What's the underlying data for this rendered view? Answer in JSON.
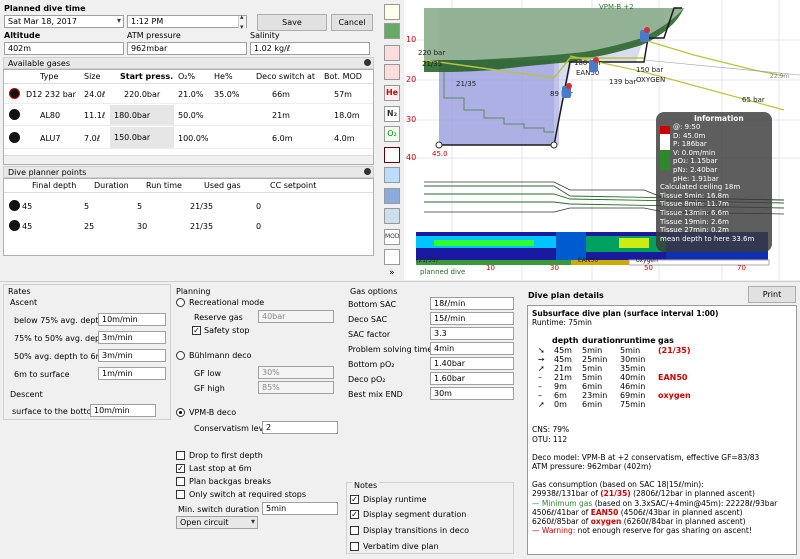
{
  "planned_dive_time": {
    "label": "Planned dive time",
    "date": "Sat Mar 18, 2017",
    "time": "1:12 PM",
    "save_label": "Save",
    "cancel_label": "Cancel"
  },
  "conditions": {
    "altitude_label": "Altitude",
    "altitude": "402m",
    "atm_label": "ATM pressure",
    "atm": "962mbar",
    "salinity_label": "Salinity",
    "salinity": "1.02 kg/ℓ"
  },
  "gases": {
    "title": "Available gases",
    "columns": [
      "Type",
      "Size",
      "Start press.",
      "O₂%",
      "He%",
      "Deco switch at",
      "Bot. MOD"
    ],
    "rows": [
      {
        "type": "D12 232 bar",
        "size": "24.0ℓ",
        "start": "220.0bar",
        "o2": "21.0%",
        "he": "35.0%",
        "deco": "66m",
        "mod": "57m"
      },
      {
        "type": "AL80",
        "size": "11.1ℓ",
        "start": "180.0bar",
        "o2": "50.0%",
        "he": "",
        "deco": "21m",
        "mod": "18.0m"
      },
      {
        "type": "ALU7",
        "size": "7.0ℓ",
        "start": "150.0bar",
        "o2": "100.0%",
        "he": "",
        "deco": "6.0m",
        "mod": "4.0m"
      }
    ]
  },
  "points": {
    "title": "Dive planner points",
    "columns": [
      "Final depth",
      "Duration",
      "Run time",
      "Used gas",
      "CC setpoint"
    ],
    "rows": [
      {
        "depth": "45",
        "duration": "5",
        "runtime": "5",
        "gas": "21/35",
        "cc": "0"
      },
      {
        "depth": "45",
        "duration": "25",
        "runtime": "30",
        "gas": "21/35",
        "cc": "0"
      }
    ]
  },
  "rates": {
    "title": "Rates",
    "ascent_label": "Ascent",
    "items": [
      {
        "label": "below 75% avg. depth",
        "value": "10m/min"
      },
      {
        "label": "75% to 50% avg. depth",
        "value": "3m/min"
      },
      {
        "label": "50% avg. depth to 6m",
        "value": "3m/min"
      },
      {
        "label": "6m to surface",
        "value": "1m/min"
      }
    ],
    "descent_label": "Descent",
    "descent_item": {
      "label": "surface to the bottom",
      "value": "10m/min"
    }
  },
  "planning": {
    "title": "Planning",
    "recreational": "Recreational mode",
    "reserve_gas_label": "Reserve gas",
    "reserve_gas": "40bar",
    "safety_stop": "Safety stop",
    "buhlmann": "Bühlmann deco",
    "gf_low_label": "GF low",
    "gf_low": "30%",
    "gf_high_label": "GF high",
    "gf_high": "85%",
    "vpmb": "VPM-B deco",
    "conservatism_label": "Conservatism level",
    "conservatism": "2",
    "drop_first": "Drop to first depth",
    "last_stop": "Last stop at 6m",
    "backgas": "Plan backgas breaks",
    "only_switch": "Only switch at required stops",
    "min_switch_label": "Min. switch duration",
    "min_switch": "5min",
    "circuit": "Open circuit"
  },
  "gas_options": {
    "title": "Gas options",
    "items": [
      {
        "label": "Bottom SAC",
        "value": "18ℓ/min"
      },
      {
        "label": "Deco SAC",
        "value": "15ℓ/min"
      },
      {
        "label": "SAC factor",
        "value": "3.3"
      },
      {
        "label": "Problem solving time",
        "value": "4min"
      },
      {
        "label": "Bottom pO₂",
        "value": "1.40bar"
      },
      {
        "label": "Deco pO₂",
        "value": "1.60bar"
      },
      {
        "label": "Best mix END",
        "value": "30m"
      }
    ]
  },
  "notes": {
    "title": "Notes",
    "display_runtime": "Display runtime",
    "display_segment": "Display segment duration",
    "display_transitions": "Display transitions in deco",
    "verbatim": "Verbatim dive plan"
  },
  "plan_details": {
    "title": "Dive plan details",
    "print_label": "Print",
    "heading": "Subsurface dive plan (surface interval 1:00)",
    "runtime": "Runtime: 75min",
    "table_header": [
      "depth",
      "duration",
      "runtime",
      "gas"
    ],
    "table_rows": [
      {
        "depth": "45m",
        "duration": "5min",
        "runtime": "5min",
        "gas": "(21/35)"
      },
      {
        "depth": "45m",
        "duration": "25min",
        "runtime": "30min",
        "gas": ""
      },
      {
        "depth": "21m",
        "duration": "5min",
        "runtime": "35min",
        "gas": ""
      },
      {
        "depth": "21m",
        "duration": "5min",
        "runtime": "40min",
        "gas": "EAN50"
      },
      {
        "depth": "9m",
        "duration": "6min",
        "runtime": "46min",
        "gas": ""
      },
      {
        "depth": "6m",
        "duration": "23min",
        "runtime": "69min",
        "gas": "oxygen"
      },
      {
        "depth": "0m",
        "duration": "6min",
        "runtime": "75min",
        "gas": ""
      }
    ],
    "cns": "CNS: 79%",
    "otu": "OTU: 112",
    "deco_model": "Deco model: VPM-B at +2 conservatism, effective GF=83/83",
    "atm": "ATM pressure: 962mbar (402m)",
    "consumption_title": "Gas consumption (based on SAC 18|15ℓ/min):",
    "consumption_1a": "29938ℓ/131bar of",
    "consumption_1b": "(21/35)",
    "consumption_1c": "(2806ℓ/12bar in planned ascent)",
    "consumption_2a": "— Minimum gas",
    "consumption_2b": "(based on 3.3xSAC/+4min@45m): 22228ℓ/93bar",
    "consumption_3a": "4506ℓ/41bar of",
    "consumption_3b": "EAN50",
    "consumption_3c": "(4506ℓ/43bar in planned ascent)",
    "consumption_4a": "6260ℓ/85bar of",
    "consumption_4b": "oxygen",
    "consumption_4c": "(6260ℓ/84bar in planned ascent)",
    "warning_a": "— Warning:",
    "warning_b": "not enough reserve for gas sharing on ascent!"
  },
  "profile": {
    "vpm_label": "VPM-B +2",
    "depth_ticks": [
      "10",
      "20",
      "30",
      "40"
    ],
    "time_ticks": [
      "10",
      "30",
      "50",
      "70"
    ],
    "labels": [
      "220 bar",
      "21/35",
      "21/35",
      "180 bar",
      "EAN50",
      "89 bar",
      "150 bar",
      "OXYGEN",
      "139 bar",
      "65 bar",
      "22.9m",
      "45.0",
      "planned dive",
      "(21/35)",
      "EAN50",
      "oxygen"
    ],
    "info_title": "Information",
    "info_lines": [
      "@: 9:50",
      "D: 45.0m",
      "P: 186bar",
      "V: 0.0m/min",
      "pO₂: 1.15bar",
      "pN₂: 2.40bar",
      "pHe: 1.91bar",
      "Calculated ceiling 18m",
      "Tissue 5min: 16.8m",
      "Tissue 8min: 11.7m",
      "Tissue 13min: 6.6m",
      "Tissue 19min: 2.6m",
      "Tissue 27min: 0.2m",
      "mean depth to here 33.6m"
    ]
  },
  "toolbar_icons": [
    "ruler-icon",
    "calculator-icon",
    "gear-icon",
    "percentage-icon",
    "helium-icon",
    "nitrogen-icon",
    "oxygen-icon",
    "ceiling-icon",
    "layers-icon",
    "tissue-icon",
    "mod-icon",
    "deco-icon",
    "more-icon"
  ],
  "toolbar_labels": [
    "",
    "",
    "",
    "",
    "He",
    "N₂",
    "O₂",
    "",
    "",
    "",
    "MOD",
    "",
    "»"
  ]
}
